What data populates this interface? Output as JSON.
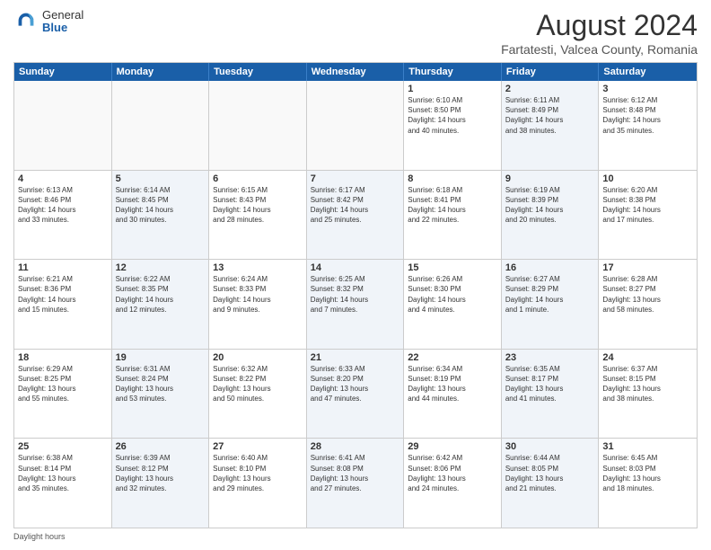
{
  "logo": {
    "general": "General",
    "blue": "Blue"
  },
  "title": "August 2024",
  "subtitle": "Fartatesti, Valcea County, Romania",
  "days_of_week": [
    "Sunday",
    "Monday",
    "Tuesday",
    "Wednesday",
    "Thursday",
    "Friday",
    "Saturday"
  ],
  "weeks": [
    [
      {
        "day": "",
        "empty": true
      },
      {
        "day": "",
        "empty": true
      },
      {
        "day": "",
        "empty": true
      },
      {
        "day": "",
        "empty": true
      },
      {
        "day": "1",
        "info": "Sunrise: 6:10 AM\nSunset: 8:50 PM\nDaylight: 14 hours\nand 40 minutes."
      },
      {
        "day": "2",
        "info": "Sunrise: 6:11 AM\nSunset: 8:49 PM\nDaylight: 14 hours\nand 38 minutes."
      },
      {
        "day": "3",
        "info": "Sunrise: 6:12 AM\nSunset: 8:48 PM\nDaylight: 14 hours\nand 35 minutes."
      }
    ],
    [
      {
        "day": "4",
        "info": "Sunrise: 6:13 AM\nSunset: 8:46 PM\nDaylight: 14 hours\nand 33 minutes."
      },
      {
        "day": "5",
        "info": "Sunrise: 6:14 AM\nSunset: 8:45 PM\nDaylight: 14 hours\nand 30 minutes."
      },
      {
        "day": "6",
        "info": "Sunrise: 6:15 AM\nSunset: 8:43 PM\nDaylight: 14 hours\nand 28 minutes."
      },
      {
        "day": "7",
        "info": "Sunrise: 6:17 AM\nSunset: 8:42 PM\nDaylight: 14 hours\nand 25 minutes."
      },
      {
        "day": "8",
        "info": "Sunrise: 6:18 AM\nSunset: 8:41 PM\nDaylight: 14 hours\nand 22 minutes."
      },
      {
        "day": "9",
        "info": "Sunrise: 6:19 AM\nSunset: 8:39 PM\nDaylight: 14 hours\nand 20 minutes."
      },
      {
        "day": "10",
        "info": "Sunrise: 6:20 AM\nSunset: 8:38 PM\nDaylight: 14 hours\nand 17 minutes."
      }
    ],
    [
      {
        "day": "11",
        "info": "Sunrise: 6:21 AM\nSunset: 8:36 PM\nDaylight: 14 hours\nand 15 minutes."
      },
      {
        "day": "12",
        "info": "Sunrise: 6:22 AM\nSunset: 8:35 PM\nDaylight: 14 hours\nand 12 minutes."
      },
      {
        "day": "13",
        "info": "Sunrise: 6:24 AM\nSunset: 8:33 PM\nDaylight: 14 hours\nand 9 minutes."
      },
      {
        "day": "14",
        "info": "Sunrise: 6:25 AM\nSunset: 8:32 PM\nDaylight: 14 hours\nand 7 minutes."
      },
      {
        "day": "15",
        "info": "Sunrise: 6:26 AM\nSunset: 8:30 PM\nDaylight: 14 hours\nand 4 minutes."
      },
      {
        "day": "16",
        "info": "Sunrise: 6:27 AM\nSunset: 8:29 PM\nDaylight: 14 hours\nand 1 minute."
      },
      {
        "day": "17",
        "info": "Sunrise: 6:28 AM\nSunset: 8:27 PM\nDaylight: 13 hours\nand 58 minutes."
      }
    ],
    [
      {
        "day": "18",
        "info": "Sunrise: 6:29 AM\nSunset: 8:25 PM\nDaylight: 13 hours\nand 55 minutes."
      },
      {
        "day": "19",
        "info": "Sunrise: 6:31 AM\nSunset: 8:24 PM\nDaylight: 13 hours\nand 53 minutes."
      },
      {
        "day": "20",
        "info": "Sunrise: 6:32 AM\nSunset: 8:22 PM\nDaylight: 13 hours\nand 50 minutes."
      },
      {
        "day": "21",
        "info": "Sunrise: 6:33 AM\nSunset: 8:20 PM\nDaylight: 13 hours\nand 47 minutes."
      },
      {
        "day": "22",
        "info": "Sunrise: 6:34 AM\nSunset: 8:19 PM\nDaylight: 13 hours\nand 44 minutes."
      },
      {
        "day": "23",
        "info": "Sunrise: 6:35 AM\nSunset: 8:17 PM\nDaylight: 13 hours\nand 41 minutes."
      },
      {
        "day": "24",
        "info": "Sunrise: 6:37 AM\nSunset: 8:15 PM\nDaylight: 13 hours\nand 38 minutes."
      }
    ],
    [
      {
        "day": "25",
        "info": "Sunrise: 6:38 AM\nSunset: 8:14 PM\nDaylight: 13 hours\nand 35 minutes."
      },
      {
        "day": "26",
        "info": "Sunrise: 6:39 AM\nSunset: 8:12 PM\nDaylight: 13 hours\nand 32 minutes."
      },
      {
        "day": "27",
        "info": "Sunrise: 6:40 AM\nSunset: 8:10 PM\nDaylight: 13 hours\nand 29 minutes."
      },
      {
        "day": "28",
        "info": "Sunrise: 6:41 AM\nSunset: 8:08 PM\nDaylight: 13 hours\nand 27 minutes."
      },
      {
        "day": "29",
        "info": "Sunrise: 6:42 AM\nSunset: 8:06 PM\nDaylight: 13 hours\nand 24 minutes."
      },
      {
        "day": "30",
        "info": "Sunrise: 6:44 AM\nSunset: 8:05 PM\nDaylight: 13 hours\nand 21 minutes."
      },
      {
        "day": "31",
        "info": "Sunrise: 6:45 AM\nSunset: 8:03 PM\nDaylight: 13 hours\nand 18 minutes."
      }
    ]
  ],
  "footer": "Daylight hours"
}
